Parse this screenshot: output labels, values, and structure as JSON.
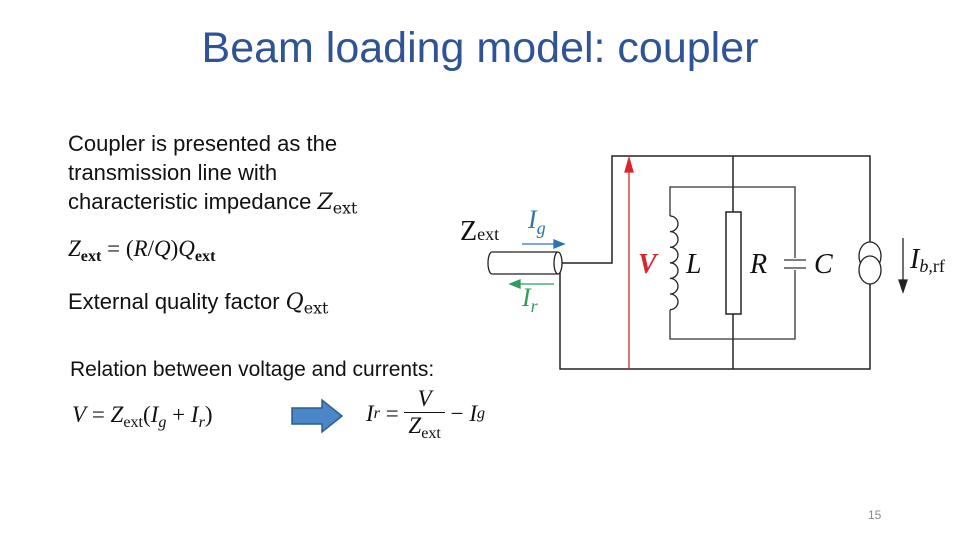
{
  "slide": {
    "title": "Beam loading model: coupler",
    "page_number": "15"
  },
  "left_text": {
    "paragraph1_line1": "Coupler is presented as the",
    "paragraph1_line2": "transmission line with",
    "paragraph1_line3": "characteristic impedance",
    "paragraph1_symbol": "Z",
    "paragraph1_symbol_sub": "ext",
    "equation1": {
      "lhs": "Z",
      "lhs_sub": "ext",
      "rhs_prefix": " = (",
      "R": "R",
      "slash": "/",
      "Q": "Q",
      "close": ")",
      "Q2": "Q",
      "Q2_sub": "ext"
    },
    "paragraph2": "External quality factor",
    "paragraph2_symbol": "Q",
    "paragraph2_symbol_sub": "ext"
  },
  "relation": {
    "heading": "Relation between voltage and currents:",
    "eq_left": {
      "V": "V",
      "eq": " = ",
      "Z": "Z",
      "Z_sub": "ext",
      "open": "(",
      "Ig": "I",
      "Ig_sub": "g",
      "plus": " + ",
      "Ir": "I",
      "Ir_sub": "r",
      "close": ")"
    },
    "arrow": "right-arrow",
    "eq_right": {
      "Ir": "I",
      "Ir_sub": "r",
      "eq": " = ",
      "numerator": "V",
      "den": "Z",
      "den_sub": "ext",
      "minus": " − ",
      "Ig": "I",
      "Ig_sub": "g"
    }
  },
  "circuit": {
    "labels": {
      "zext": "Z",
      "zext_sub": "ext",
      "ig": "I",
      "ig_sub": "g",
      "ir": "I",
      "ir_sub": "r",
      "v": "V",
      "l": "L",
      "r": "R",
      "c": "C",
      "ib": "I",
      "ib_sub": "b,",
      "ib_sub2": "rf"
    },
    "colors": {
      "ig": "#2e75b6",
      "ir": "#2e9e5b",
      "v": "#d9262c",
      "wire": "#222222",
      "arrow_fill": "#4a86c8",
      "arrow_stroke": "#2f5d8e"
    }
  }
}
